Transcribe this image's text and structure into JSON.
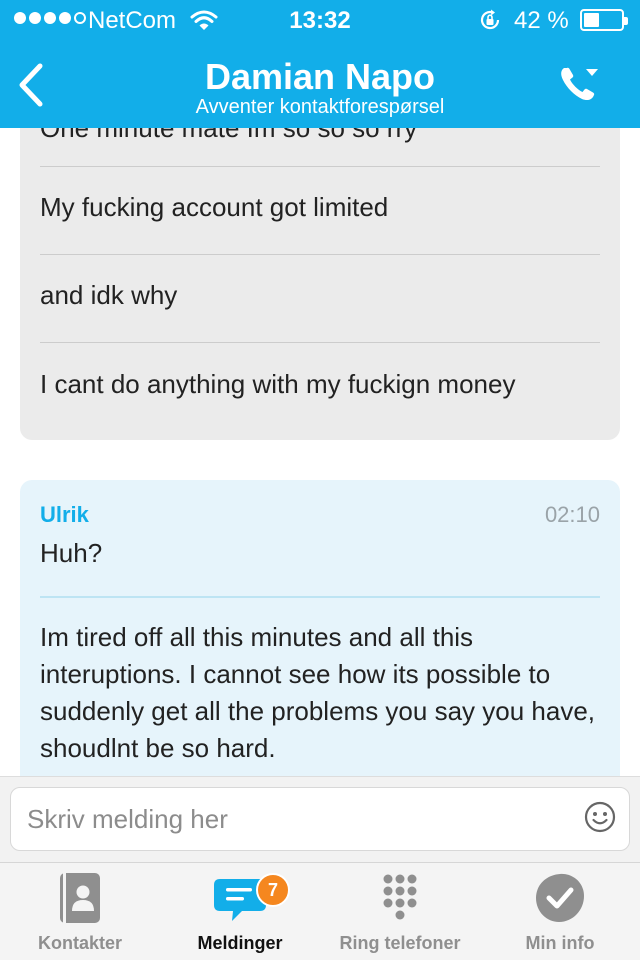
{
  "status_bar": {
    "carrier": "NetCom",
    "time": "13:32",
    "battery": "42 %",
    "battery_level": 0.42,
    "icons": [
      "signal-dots-icon",
      "wifi-icon",
      "rotation-lock-icon",
      "battery-icon"
    ]
  },
  "nav": {
    "title": "Damian Napo",
    "subtitle": "Avventer kontaktforespørsel",
    "back_icon": "chevron-left-icon",
    "call_icon": "phone-call-icon"
  },
  "conversation": {
    "incoming": {
      "lines": [
        "One minute mate Im so so so rry",
        "My fucking account got limited",
        "and idk why",
        "I cant do anything with my fuckign money"
      ]
    },
    "outgoing": {
      "sender": "Ulrik",
      "time": "02:10",
      "messages": [
        "Huh?",
        "Im tired off all this minutes and all this interuptions. I cannot see how its possible to suddenly get all the problems you say you have, shoudlnt be so hard."
      ]
    }
  },
  "composer": {
    "placeholder": "Skriv melding her",
    "emoji_icon": "smiley-icon"
  },
  "tabbar": {
    "tabs": [
      {
        "label": "Kontakter",
        "icon": "contacts-icon"
      },
      {
        "label": "Meldinger",
        "icon": "chat-bubble-icon",
        "badge": "7",
        "active": true
      },
      {
        "label": "Ring telefoner",
        "icon": "keypad-icon"
      },
      {
        "label": "Min info",
        "icon": "profile-check-icon"
      }
    ]
  },
  "colors": {
    "accent": "#12aee9",
    "incoming_bubble": "#ebebeb",
    "outgoing_bubble": "#e6f4fb",
    "badge": "#f5871f"
  }
}
